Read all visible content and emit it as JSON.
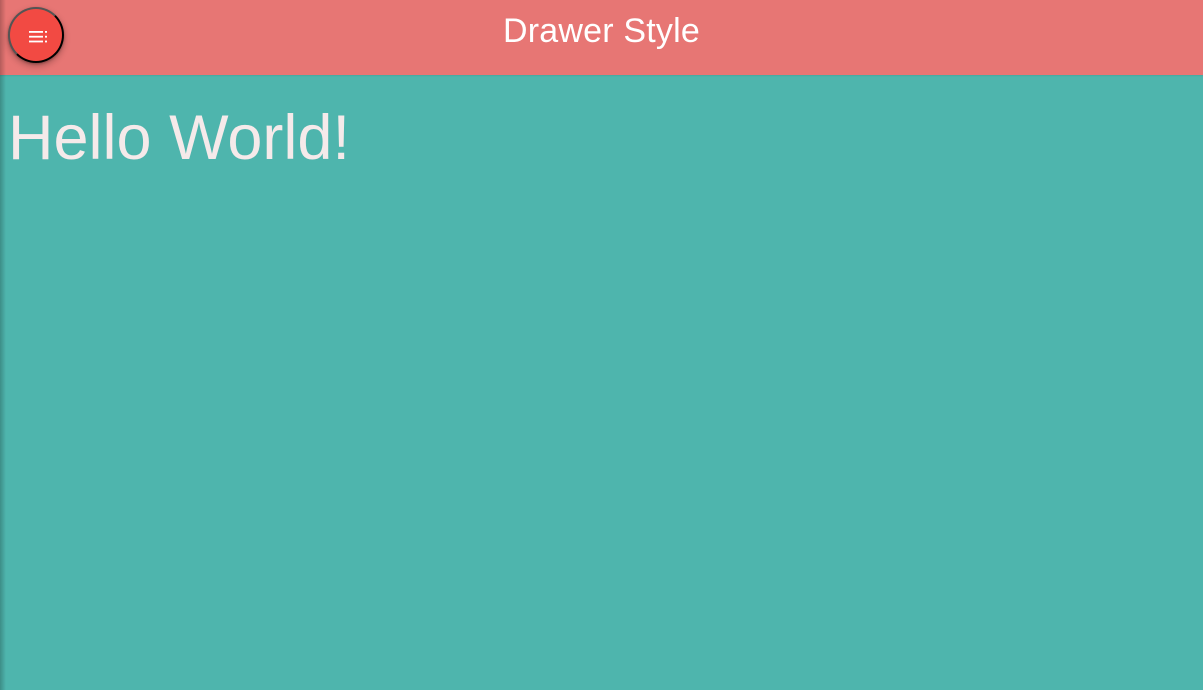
{
  "header": {
    "title": "Drawer Style"
  },
  "menu_button": {
    "icon": "menu-icon"
  },
  "main": {
    "heading": "Hello World!"
  },
  "colors": {
    "header_background": "#e77674",
    "content_background": "#4eb5ad",
    "fab_background": "#f24a43",
    "text_color": "#f5eaea",
    "title_color": "#ffffff"
  }
}
